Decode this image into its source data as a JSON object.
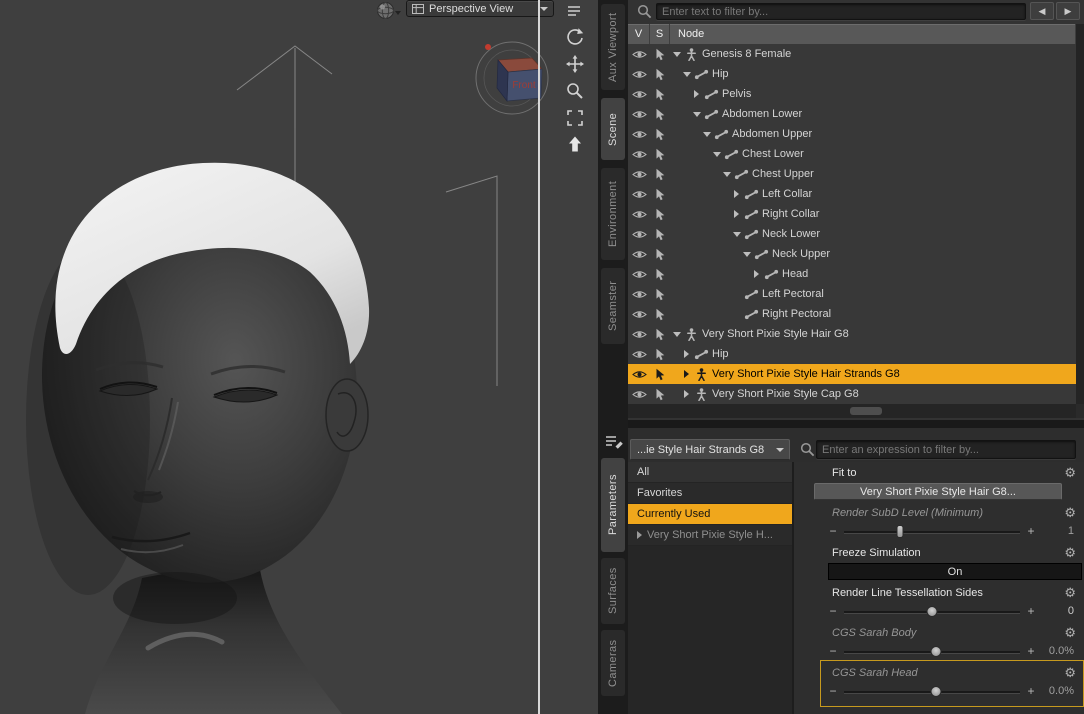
{
  "colors": {
    "selection": "#f0a71c",
    "highlight_border": "#c79a1e"
  },
  "icons": {
    "gear": "⚙",
    "nav_back": "◀",
    "nav_forward": "▶"
  },
  "viewport": {
    "view_selector_label": "Perspective View",
    "view_cube_front": "Front",
    "tools": [
      "viewport-menu",
      "orbit-tool",
      "pan-tool",
      "zoom-tool",
      "frame-tool",
      "aim-tool"
    ]
  },
  "dock_tabs": {
    "top": [
      {
        "label": "Aux Viewport",
        "active": false
      },
      {
        "label": "Scene",
        "active": true
      },
      {
        "label": "Environment",
        "active": false
      },
      {
        "label": "Seamster",
        "active": false
      }
    ],
    "bottom": [
      {
        "label": "Parameters",
        "active": true
      },
      {
        "label": "Surfaces",
        "active": false
      },
      {
        "label": "Cameras",
        "active": false
      }
    ]
  },
  "scene_pane": {
    "filter_placeholder": "Enter text to filter by...",
    "columns": [
      "V",
      "S",
      "Node"
    ],
    "tree": [
      {
        "label": "Genesis 8 Female",
        "indent": 0,
        "expand": "open",
        "icon": "figure",
        "selected": false
      },
      {
        "label": "Hip",
        "indent": 1,
        "expand": "open",
        "icon": "bone",
        "selected": false
      },
      {
        "label": "Pelvis",
        "indent": 2,
        "expand": "closed",
        "icon": "bone",
        "selected": false
      },
      {
        "label": "Abdomen Lower",
        "indent": 2,
        "expand": "open",
        "icon": "bone",
        "selected": false
      },
      {
        "label": "Abdomen Upper",
        "indent": 3,
        "expand": "open",
        "icon": "bone",
        "selected": false
      },
      {
        "label": "Chest Lower",
        "indent": 4,
        "expand": "open",
        "icon": "bone",
        "selected": false
      },
      {
        "label": "Chest Upper",
        "indent": 5,
        "expand": "open",
        "icon": "bone",
        "selected": false
      },
      {
        "label": "Left Collar",
        "indent": 6,
        "expand": "closed",
        "icon": "bone",
        "selected": false
      },
      {
        "label": "Right Collar",
        "indent": 6,
        "expand": "closed",
        "icon": "bone",
        "selected": false
      },
      {
        "label": "Neck Lower",
        "indent": 6,
        "expand": "open",
        "icon": "bone",
        "selected": false
      },
      {
        "label": "Neck Upper",
        "indent": 7,
        "expand": "open",
        "icon": "bone",
        "selected": false
      },
      {
        "label": "Head",
        "indent": 8,
        "expand": "closed",
        "icon": "bone",
        "selected": false
      },
      {
        "label": "Left Pectoral",
        "indent": 6,
        "expand": "none",
        "icon": "bone",
        "selected": false
      },
      {
        "label": "Right Pectoral",
        "indent": 6,
        "expand": "none",
        "icon": "bone",
        "selected": false
      },
      {
        "label": "Very Short Pixie Style Hair G8",
        "indent": 0,
        "expand": "open",
        "icon": "figure",
        "selected": false
      },
      {
        "label": "Hip",
        "indent": 1,
        "expand": "closed",
        "icon": "bone",
        "selected": false
      },
      {
        "label": "Very Short Pixie Style Hair Strands G8",
        "indent": 1,
        "expand": "closed",
        "icon": "figure",
        "selected": true
      },
      {
        "label": "Very Short Pixie Style Cap G8",
        "indent": 1,
        "expand": "closed",
        "icon": "figure",
        "selected": false
      }
    ]
  },
  "params_pane": {
    "node_selector_value": "...ie Style Hair Strands G8",
    "filter_placeholder": "Enter an expression to filter by...",
    "slider_minus": "−",
    "slider_plus": "+",
    "groups": [
      {
        "label": "All",
        "selected": false,
        "arrow": false,
        "dim": false
      },
      {
        "label": "Favorites",
        "selected": false,
        "arrow": false,
        "dim": false
      },
      {
        "label": "Currently Used",
        "selected": true,
        "arrow": false,
        "dim": false
      },
      {
        "label": "Very Short Pixie Style H...",
        "selected": false,
        "arrow": true,
        "dim": true
      }
    ],
    "params": [
      {
        "label": "Fit to",
        "type": "button",
        "value": "Very Short Pixie Style Hair G8...",
        "muted": false,
        "highlighted": false
      },
      {
        "label": "Render SubD Level (Minimum)",
        "type": "slider",
        "value": "1",
        "pos": 32,
        "handle": "bar",
        "muted": true,
        "highlighted": false
      },
      {
        "label": "Freeze Simulation",
        "type": "toggle",
        "value": "On",
        "muted": false,
        "highlighted": false
      },
      {
        "label": "Render Line Tessellation Sides",
        "type": "slider",
        "value": "0",
        "pos": 50,
        "handle": "dot",
        "muted": false,
        "highlighted": false
      },
      {
        "label": "CGS Sarah Body",
        "type": "slider",
        "value": "0.0%",
        "pos": 52,
        "handle": "dot",
        "muted": true,
        "highlighted": false
      },
      {
        "label": "CGS Sarah Head",
        "type": "slider",
        "value": "0.0%",
        "pos": 52,
        "handle": "dot",
        "muted": true,
        "highlighted": true
      }
    ]
  }
}
